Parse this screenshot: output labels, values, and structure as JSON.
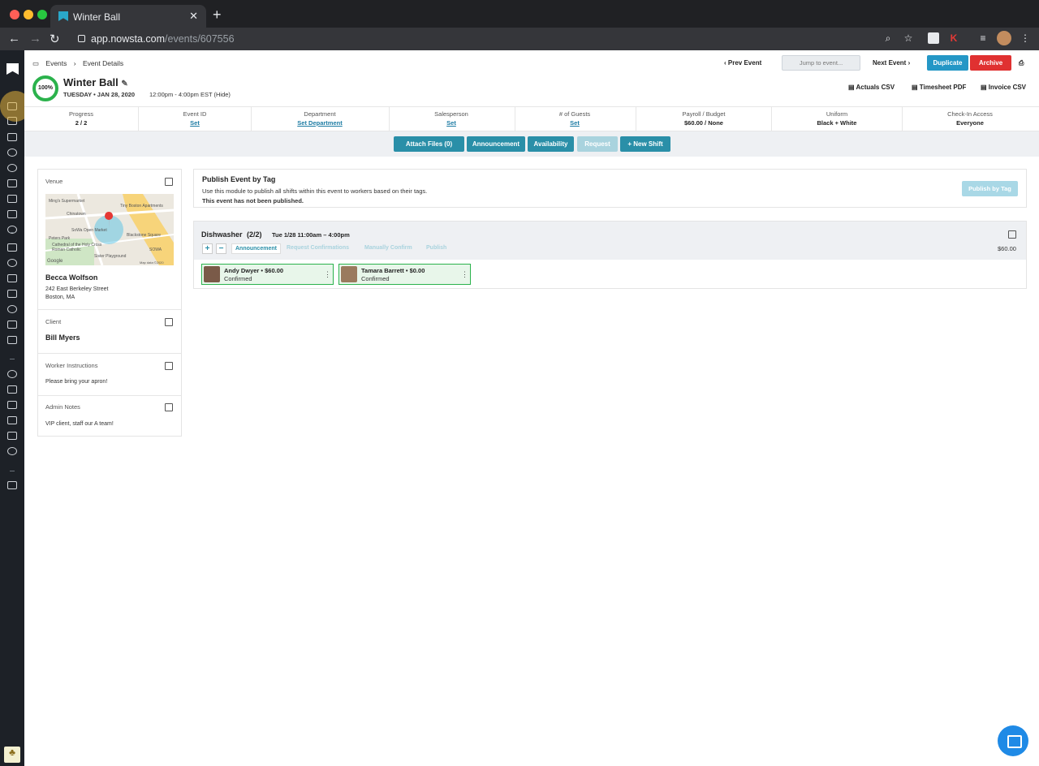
{
  "browser": {
    "tab_title": "Winter Ball",
    "url_host": "app.nowsta.com",
    "url_path": "/events/607556",
    "new_tab": "+",
    "close": "✕"
  },
  "breadcrumb": {
    "root": "Events",
    "sep": "›",
    "current": "Event Details"
  },
  "event": {
    "title": "Winter Ball",
    "progress_pct": "100%",
    "date": "TUESDAY • JAN 28, 2020",
    "time": "12:00pm - 4:00pm EST (Hide)"
  },
  "topnav": {
    "prev": "Prev Event",
    "jump_placeholder": "Jump to event...",
    "next": "Next Event",
    "duplicate": "Duplicate",
    "archive": "Archive"
  },
  "downloads": {
    "actuals": "Actuals CSV",
    "timesheet": "Timesheet PDF",
    "invoice": "Invoice CSV"
  },
  "stats": [
    {
      "label": "Progress",
      "value": "2 / 2"
    },
    {
      "label": "Event ID",
      "value": "Set"
    },
    {
      "label": "Department",
      "value": "Set Department"
    },
    {
      "label": "Salesperson",
      "value": "Set"
    },
    {
      "label": "# of Guests",
      "value": "Set"
    },
    {
      "label": "Payroll / Budget",
      "value": "$60.00 / None"
    },
    {
      "label": "Uniform",
      "value": "Black + White"
    },
    {
      "label": "Check-In Access",
      "value": "Everyone"
    }
  ],
  "actions": {
    "attach": "Attach Files (0)",
    "announcement": "Announcement",
    "availability": "Availability",
    "request": "Request",
    "new_shift": "+ New Shift"
  },
  "venue_card": {
    "label": "Venue",
    "name": "Becca Wolfson",
    "street": "242 East Berkeley Street",
    "city": "Boston, MA",
    "client_label": "Client",
    "client": "Bill Myers",
    "instr_label": "Worker Instructions",
    "instructions": "Please bring your apron!",
    "notes_label": "Admin Notes",
    "notes": "VIP client, staff our A team!",
    "map_labels": [
      "Ming's Supermarket",
      "Tiny Boston Apartments",
      "Chinatown",
      "SoWa Open Market",
      "Peters Park",
      "Cathedral of the Holy Cross",
      "Roman Catholic",
      "Blackstone Square",
      "Google",
      "Map data ©2020",
      "Sister Playground",
      "SOWA"
    ]
  },
  "publish": {
    "title": "Publish Event by Tag",
    "desc": "Use this module to publish all shifts within this event to workers based on their tags.",
    "status": "This event has not been published.",
    "button": "Publish by Tag"
  },
  "shift": {
    "role": "Dishwasher",
    "count": "(2/2)",
    "when": "Tue 1/28 11:00am – 4:00pm",
    "rate": "$60.00",
    "plus": "+",
    "minus": "−",
    "announcement": "Announcement",
    "request_conf": "Request Confirmations",
    "manual_conf": "Manually Confirm",
    "publish": "Publish"
  },
  "workers": [
    {
      "name": "Andy Dwyer • $60.00",
      "status": "Confirmed"
    },
    {
      "name": "Tamara Barrett • $0.00",
      "status": "Confirmed"
    }
  ],
  "colors": {
    "accent": "#2a8fa8",
    "success": "#2bb24c",
    "danger": "#e03131",
    "primary": "#2497c6"
  }
}
